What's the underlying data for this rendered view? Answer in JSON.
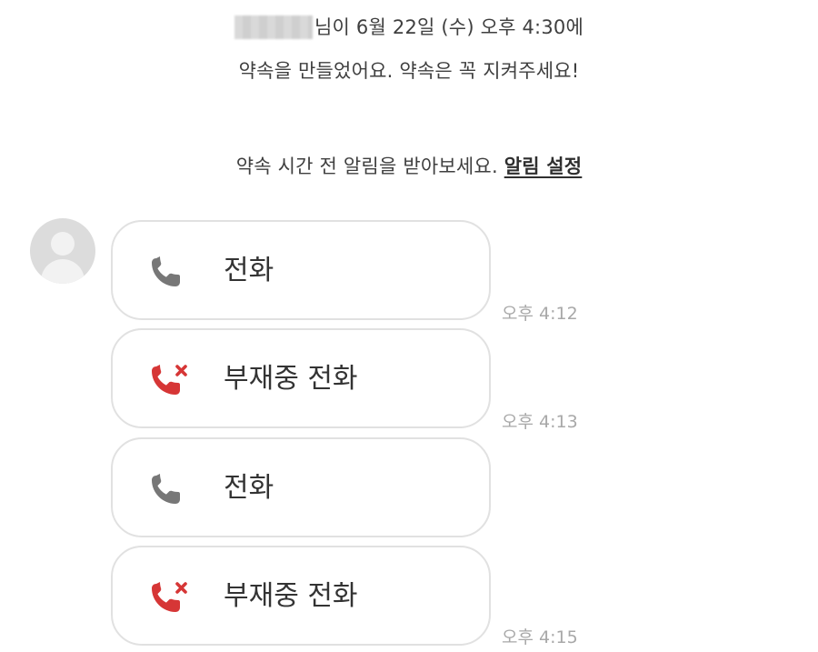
{
  "colors": {
    "background": "#ffffff",
    "bubble_border": "#e1e1e1",
    "missed_call_red": "#d63636",
    "call_gray": "#757575",
    "timestamp_gray": "#a8a8a8"
  },
  "notice": {
    "line1_suffix": "님이 6월 22일 (수) 오후 4:30에",
    "line2": "약속을 만들었어요. 약속은 꼭 지켜주세요!",
    "reminder_text": "약속 시간 전 알림을 받아보세요.",
    "reminder_link": "알림 설정"
  },
  "avatar": {
    "icon": "default-profile-icon"
  },
  "calls": [
    {
      "type": "call",
      "icon": "phone-icon",
      "label": "전화",
      "time": "오후 4:12"
    },
    {
      "type": "missed-call",
      "icon": "missed-call-icon",
      "label": "부재중 전화",
      "time": "오후 4:13"
    },
    {
      "type": "call",
      "icon": "phone-icon",
      "label": "전화",
      "time": ""
    },
    {
      "type": "missed-call",
      "icon": "missed-call-icon",
      "label": "부재중 전화",
      "time": "오후 4:15"
    }
  ]
}
